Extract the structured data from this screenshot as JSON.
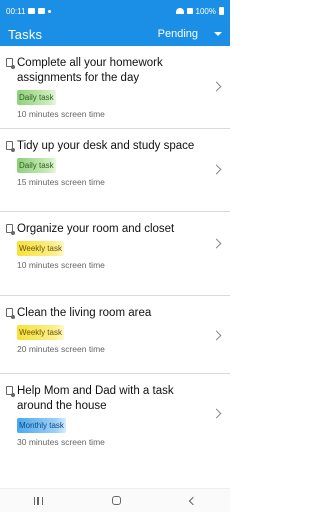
{
  "status_bar": {
    "time": "00:11",
    "battery": "100%"
  },
  "app_bar": {
    "title": "Tasks",
    "filter_label": "Pending"
  },
  "tasks": [
    {
      "title": "Complete all your homework assignments for the day",
      "badge": "Daily task",
      "badge_type": "daily",
      "screen_time": "10 minutes screen time"
    },
    {
      "title": "Tidy up your desk and study space",
      "badge": "Daily task",
      "badge_type": "daily",
      "screen_time": "15 minutes screen time"
    },
    {
      "title": "Organize your room and closet",
      "badge": "Weekly task",
      "badge_type": "weekly",
      "screen_time": "10 minutes screen time"
    },
    {
      "title": "Clean the living room area",
      "badge": "Weekly task",
      "badge_type": "weekly",
      "screen_time": "20 minutes screen time"
    },
    {
      "title": "Help Mom and Dad with a task around the house",
      "badge": "Monthly task",
      "badge_type": "monthly",
      "screen_time": "30 minutes screen time"
    }
  ],
  "colors": {
    "app_bar": "#1b8fe6",
    "daily": "#8fd07a",
    "weekly": "#f7e13a",
    "monthly": "#4aa8f0"
  },
  "icons": {
    "task": "document-icon",
    "row_action": "chevron-right-icon",
    "filter": "caret-down-icon"
  }
}
